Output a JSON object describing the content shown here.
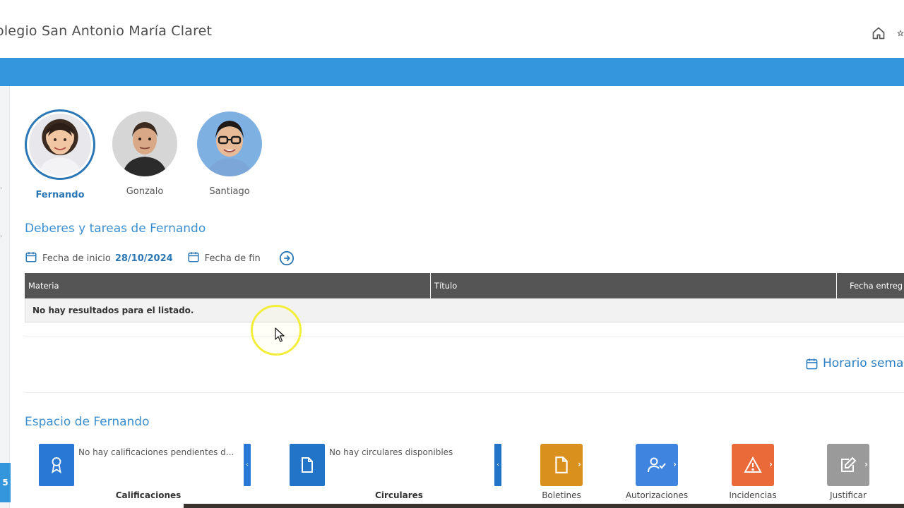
{
  "header": {
    "school_title": "olegio San Antonio María Claret"
  },
  "left_badge": "5",
  "students": [
    {
      "name": "Fernando",
      "active": true
    },
    {
      "name": "Gonzalo",
      "active": false
    },
    {
      "name": "Santiago",
      "active": false
    }
  ],
  "homework": {
    "title": "Deberes y tareas de Fernando",
    "start_label": "Fecha de inicio",
    "start_value": "28/10/2024",
    "end_label": "Fecha de fin",
    "columns": [
      "Materia",
      "Título",
      "Fecha entreg"
    ],
    "empty_message": "No hay resultados para el listado."
  },
  "schedule_link": "Horario sema",
  "space": {
    "title": "Espacio de Fernando",
    "cards": [
      {
        "text": "No hay calificaciones pendientes d...",
        "label": "Calificaciones",
        "color": "#2a78d6"
      },
      {
        "text": "No hay circulares disponibles",
        "label": "Circulares",
        "color": "#2a78d6"
      }
    ],
    "tiles": [
      {
        "label": "Boletines",
        "color": "#d9901c",
        "icon": "document-icon"
      },
      {
        "label": "Autorizaciones",
        "color": "#3f85e0",
        "icon": "user-check-icon"
      },
      {
        "label": "Incidencias",
        "color": "#ea6a3a",
        "icon": "warning-icon"
      },
      {
        "label": "Justificar",
        "color": "#9a9a9a",
        "icon": "edit-icon"
      }
    ]
  },
  "colors": {
    "brand_blue": "#3497de",
    "link_blue": "#2b77b5",
    "table_header": "#555555"
  }
}
